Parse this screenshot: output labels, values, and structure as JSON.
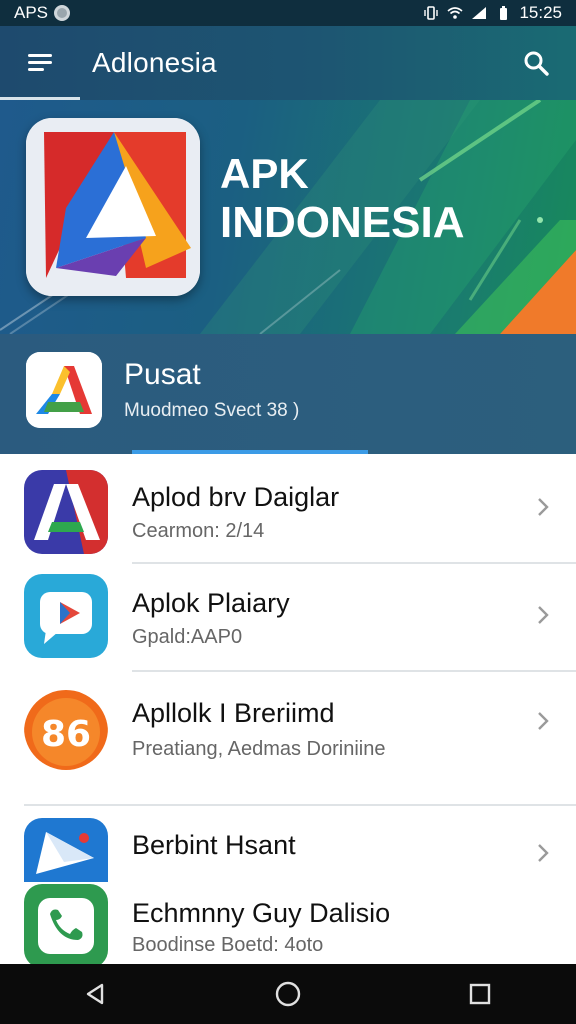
{
  "status_bar": {
    "carrier": "APS",
    "time": "15:25",
    "icons": [
      "vibrate-icon",
      "wifi-icon",
      "signal-icon",
      "battery-icon"
    ]
  },
  "app_bar": {
    "title": "Adlonesia",
    "menu_icon": "hamburger-menu-icon",
    "search_icon": "search-icon"
  },
  "banner": {
    "title_line1": "APK",
    "title_line2": "INDONESIA",
    "logo_icon": "apk-indonesia-logo-icon"
  },
  "featured": {
    "name": "Pusat",
    "subtitle": "Muodmeo Svect 38 )",
    "progress_fraction": 0.41,
    "icon": "a-letter-icon"
  },
  "apps": [
    {
      "name": "Aplod brv Daiglar",
      "subtitle": "Cearmon: 2/14",
      "icon": "a-logo-icon",
      "accent": "#d32f2f"
    },
    {
      "name": "Aplok Plaiary",
      "subtitle": "Gpald:AAP0",
      "icon": "play-chat-icon",
      "accent": "#29a9d8"
    },
    {
      "name": "Apllolk I Breriimd",
      "subtitle": "Preatiang, Aedmas Doriniine",
      "icon": "number-badge-icon",
      "accent": "#f06a1a"
    },
    {
      "name": "Berbint Hsant",
      "subtitle": "",
      "icon": "paper-plane-icon",
      "accent": "#1f78d1"
    },
    {
      "name": "Echmnny Guy Dalisio",
      "subtitle": "Boodinse Boetd: 4oto",
      "icon": "phone-chat-icon",
      "accent": "#2e9a4f"
    }
  ],
  "nav_bar": {
    "back_icon": "back-triangle-icon",
    "home_icon": "home-circle-icon",
    "recents_icon": "recents-square-icon"
  },
  "colors": {
    "app_bar": "#1e4a6e",
    "featured": "#2b5b7f",
    "progress": "#3b9be6",
    "nav_bar": "#0b0b0b"
  }
}
